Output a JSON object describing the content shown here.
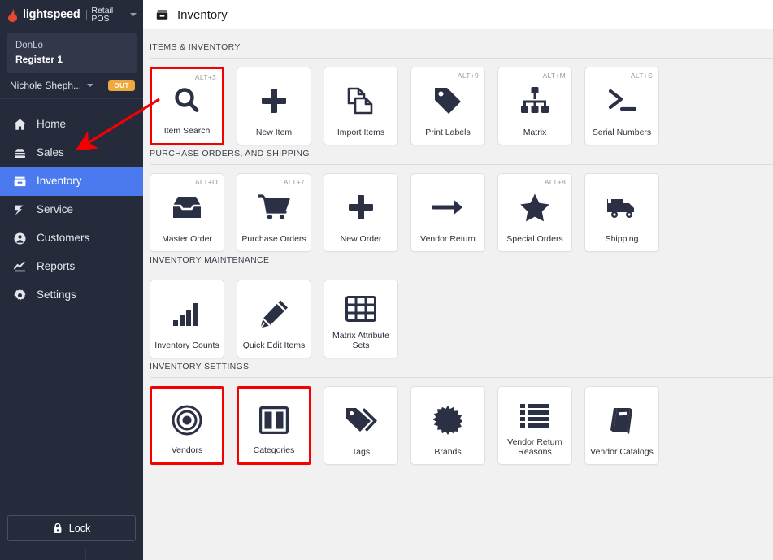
{
  "brand": {
    "logo_icon": "flame-icon",
    "name": "lightspeed",
    "product": "Retail POS",
    "caret_icon": "chevron-down-icon"
  },
  "sidebar": {
    "store": {
      "name": "DonLo",
      "register": "Register 1"
    },
    "user": {
      "name": "Nichole Sheph...",
      "caret_icon": "chevron-down-icon",
      "status_badge": "OUT",
      "status_color": "#f0a93c"
    },
    "active_color": "#4a7aed",
    "background_color": "#262b3c",
    "items": [
      {
        "label": "Home",
        "icon": "home-icon",
        "active": false
      },
      {
        "label": "Sales",
        "icon": "sales-register-icon",
        "active": false
      },
      {
        "label": "Inventory",
        "icon": "inventory-box-icon",
        "active": true
      },
      {
        "label": "Service",
        "icon": "wrench-icon",
        "active": false
      },
      {
        "label": "Customers",
        "icon": "person-icon",
        "active": false
      },
      {
        "label": "Reports",
        "icon": "chart-line-icon",
        "active": false
      },
      {
        "label": "Settings",
        "icon": "gear-icon",
        "active": false
      }
    ],
    "lock_button": {
      "label": "Lock",
      "icon": "lock-icon"
    }
  },
  "header": {
    "title": "Inventory",
    "icon": "inventory-box-icon"
  },
  "sections": [
    {
      "title": "ITEMS & INVENTORY",
      "tiles": [
        {
          "label": "Item Search",
          "shortcut": "ALT+3",
          "icon": "magnifier-icon",
          "highlighted": true
        },
        {
          "label": "New Item",
          "shortcut": "",
          "icon": "plus-icon",
          "highlighted": false
        },
        {
          "label": "Import Items",
          "shortcut": "",
          "icon": "copy-pages-icon",
          "highlighted": false
        },
        {
          "label": "Print Labels",
          "shortcut": "ALT+9",
          "icon": "tag-icon",
          "highlighted": false
        },
        {
          "label": "Matrix",
          "shortcut": "ALT+M",
          "icon": "hierarchy-icon",
          "highlighted": false
        },
        {
          "label": "Serial Numbers",
          "shortcut": "ALT+S",
          "icon": "terminal-prompt-icon",
          "highlighted": false
        }
      ]
    },
    {
      "title": "PURCHASE ORDERS, AND SHIPPING",
      "tiles": [
        {
          "label": "Master Order",
          "shortcut": "ALT+O",
          "icon": "inbox-tray-icon",
          "highlighted": false
        },
        {
          "label": "Purchase Orders",
          "shortcut": "ALT+7",
          "icon": "shopping-cart-icon",
          "highlighted": false
        },
        {
          "label": "New Order",
          "shortcut": "",
          "icon": "plus-icon",
          "highlighted": false
        },
        {
          "label": "Vendor Return",
          "shortcut": "",
          "icon": "arrow-right-icon",
          "highlighted": false
        },
        {
          "label": "Special Orders",
          "shortcut": "ALT+8",
          "icon": "star-icon",
          "highlighted": false
        },
        {
          "label": "Shipping",
          "shortcut": "",
          "icon": "truck-icon",
          "highlighted": false
        }
      ]
    },
    {
      "title": "INVENTORY MAINTENANCE",
      "tiles": [
        {
          "label": "Inventory Counts",
          "shortcut": "",
          "icon": "bar-chart-icon",
          "highlighted": false
        },
        {
          "label": "Quick Edit Items",
          "shortcut": "",
          "icon": "pencil-icon",
          "highlighted": false
        },
        {
          "label": "Matrix Attribute Sets",
          "shortcut": "",
          "icon": "grid-table-icon",
          "highlighted": false
        }
      ]
    },
    {
      "title": "INVENTORY SETTINGS",
      "tiles": [
        {
          "label": "Vendors",
          "shortcut": "",
          "icon": "target-circles-icon",
          "highlighted": true
        },
        {
          "label": "Categories",
          "shortcut": "",
          "icon": "columns-icon",
          "highlighted": true
        },
        {
          "label": "Tags",
          "shortcut": "",
          "icon": "double-tag-icon",
          "highlighted": false
        },
        {
          "label": "Brands",
          "shortcut": "",
          "icon": "burst-star-icon",
          "highlighted": false
        },
        {
          "label": "Vendor Return Reasons",
          "shortcut": "",
          "icon": "list-icon",
          "highlighted": false
        },
        {
          "label": "Vendor Catalogs",
          "shortcut": "",
          "icon": "book-icon",
          "highlighted": false
        }
      ]
    }
  ],
  "annotations": {
    "arrow_color": "#f40000",
    "highlight_color": "#f40000"
  }
}
